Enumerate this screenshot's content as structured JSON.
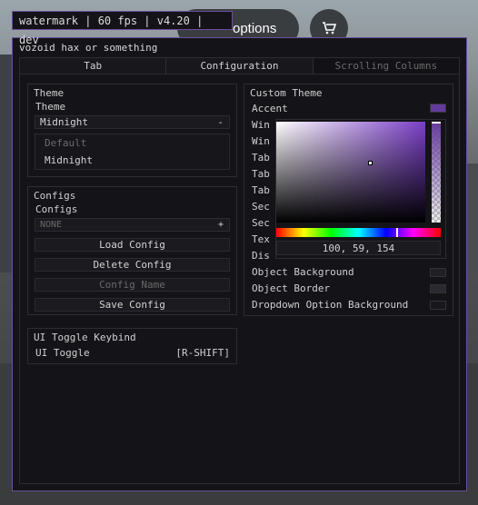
{
  "background": {
    "options_label": "options",
    "cart_icon": "cart-icon"
  },
  "watermark": "watermark | 60 fps | v4.20 | dev",
  "window": {
    "title": "vozoid hax or something",
    "tabs": [
      "Tab",
      "Configuration",
      "Scrolling Columns"
    ],
    "active_tab": "Tab"
  },
  "theme_section": {
    "title": "Theme",
    "dropdown_label": "Theme",
    "selected": "Midnight",
    "sign": "-",
    "options": [
      "Default",
      "Midnight"
    ]
  },
  "configs_section": {
    "title": "Configs",
    "dropdown_label": "Configs",
    "selected": "NONE",
    "sign": "+",
    "load_button": "Load Config",
    "delete_button": "Delete Config",
    "name_placeholder": "Config Name",
    "save_button": "Save Config"
  },
  "keybind_section": {
    "title": "UI Toggle Keybind",
    "label": "UI Toggle",
    "key": "[R-SHIFT]"
  },
  "custom_theme": {
    "title": "Custom Theme",
    "accent_label": "Accent",
    "accent_color": "#643b9a",
    "hidden_rows": [
      "Win",
      "Win",
      "Tab",
      "Tab",
      "Tab",
      "Sec",
      "Sec",
      "Tex",
      "Dis"
    ],
    "rows": [
      {
        "label": "Object Background",
        "color": "#1f1f24"
      },
      {
        "label": "Object Border",
        "color": "#2a2a30"
      },
      {
        "label": "Dropdown Option Background",
        "color": "#18181c"
      }
    ],
    "picker": {
      "rgb_value": "100, 59, 154",
      "hue_color": "#7a3fc8"
    }
  }
}
